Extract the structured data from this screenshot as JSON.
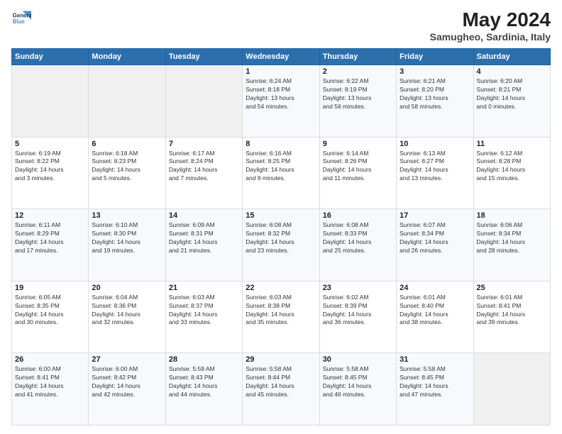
{
  "logo": {
    "line1": "General",
    "line2": "Blue"
  },
  "title": "May 2024",
  "location": "Samugheo, Sardinia, Italy",
  "weekdays": [
    "Sunday",
    "Monday",
    "Tuesday",
    "Wednesday",
    "Thursday",
    "Friday",
    "Saturday"
  ],
  "weeks": [
    [
      {
        "day": "",
        "info": ""
      },
      {
        "day": "",
        "info": ""
      },
      {
        "day": "",
        "info": ""
      },
      {
        "day": "1",
        "info": "Sunrise: 6:24 AM\nSunset: 8:18 PM\nDaylight: 13 hours\nand 54 minutes."
      },
      {
        "day": "2",
        "info": "Sunrise: 6:22 AM\nSunset: 8:19 PM\nDaylight: 13 hours\nand 56 minutes."
      },
      {
        "day": "3",
        "info": "Sunrise: 6:21 AM\nSunset: 8:20 PM\nDaylight: 13 hours\nand 58 minutes."
      },
      {
        "day": "4",
        "info": "Sunrise: 6:20 AM\nSunset: 8:21 PM\nDaylight: 14 hours\nand 0 minutes."
      }
    ],
    [
      {
        "day": "5",
        "info": "Sunrise: 6:19 AM\nSunset: 8:22 PM\nDaylight: 14 hours\nand 3 minutes."
      },
      {
        "day": "6",
        "info": "Sunrise: 6:18 AM\nSunset: 8:23 PM\nDaylight: 14 hours\nand 5 minutes."
      },
      {
        "day": "7",
        "info": "Sunrise: 6:17 AM\nSunset: 8:24 PM\nDaylight: 14 hours\nand 7 minutes."
      },
      {
        "day": "8",
        "info": "Sunrise: 6:16 AM\nSunset: 8:25 PM\nDaylight: 14 hours\nand 9 minutes."
      },
      {
        "day": "9",
        "info": "Sunrise: 6:14 AM\nSunset: 8:26 PM\nDaylight: 14 hours\nand 11 minutes."
      },
      {
        "day": "10",
        "info": "Sunrise: 6:13 AM\nSunset: 8:27 PM\nDaylight: 14 hours\nand 13 minutes."
      },
      {
        "day": "11",
        "info": "Sunrise: 6:12 AM\nSunset: 8:28 PM\nDaylight: 14 hours\nand 15 minutes."
      }
    ],
    [
      {
        "day": "12",
        "info": "Sunrise: 6:11 AM\nSunset: 8:29 PM\nDaylight: 14 hours\nand 17 minutes."
      },
      {
        "day": "13",
        "info": "Sunrise: 6:10 AM\nSunset: 8:30 PM\nDaylight: 14 hours\nand 19 minutes."
      },
      {
        "day": "14",
        "info": "Sunrise: 6:09 AM\nSunset: 8:31 PM\nDaylight: 14 hours\nand 21 minutes."
      },
      {
        "day": "15",
        "info": "Sunrise: 6:08 AM\nSunset: 8:32 PM\nDaylight: 14 hours\nand 23 minutes."
      },
      {
        "day": "16",
        "info": "Sunrise: 6:08 AM\nSunset: 8:33 PM\nDaylight: 14 hours\nand 25 minutes."
      },
      {
        "day": "17",
        "info": "Sunrise: 6:07 AM\nSunset: 8:34 PM\nDaylight: 14 hours\nand 26 minutes."
      },
      {
        "day": "18",
        "info": "Sunrise: 6:06 AM\nSunset: 8:34 PM\nDaylight: 14 hours\nand 28 minutes."
      }
    ],
    [
      {
        "day": "19",
        "info": "Sunrise: 6:05 AM\nSunset: 8:35 PM\nDaylight: 14 hours\nand 30 minutes."
      },
      {
        "day": "20",
        "info": "Sunrise: 6:04 AM\nSunset: 8:36 PM\nDaylight: 14 hours\nand 32 minutes."
      },
      {
        "day": "21",
        "info": "Sunrise: 6:03 AM\nSunset: 8:37 PM\nDaylight: 14 hours\nand 33 minutes."
      },
      {
        "day": "22",
        "info": "Sunrise: 6:03 AM\nSunset: 8:38 PM\nDaylight: 14 hours\nand 35 minutes."
      },
      {
        "day": "23",
        "info": "Sunrise: 6:02 AM\nSunset: 8:39 PM\nDaylight: 14 hours\nand 36 minutes."
      },
      {
        "day": "24",
        "info": "Sunrise: 6:01 AM\nSunset: 8:40 PM\nDaylight: 14 hours\nand 38 minutes."
      },
      {
        "day": "25",
        "info": "Sunrise: 6:01 AM\nSunset: 8:41 PM\nDaylight: 14 hours\nand 39 minutes."
      }
    ],
    [
      {
        "day": "26",
        "info": "Sunrise: 6:00 AM\nSunset: 8:41 PM\nDaylight: 14 hours\nand 41 minutes."
      },
      {
        "day": "27",
        "info": "Sunrise: 6:00 AM\nSunset: 8:42 PM\nDaylight: 14 hours\nand 42 minutes."
      },
      {
        "day": "28",
        "info": "Sunrise: 5:59 AM\nSunset: 8:43 PM\nDaylight: 14 hours\nand 44 minutes."
      },
      {
        "day": "29",
        "info": "Sunrise: 5:58 AM\nSunset: 8:44 PM\nDaylight: 14 hours\nand 45 minutes."
      },
      {
        "day": "30",
        "info": "Sunrise: 5:58 AM\nSunset: 8:45 PM\nDaylight: 14 hours\nand 46 minutes."
      },
      {
        "day": "31",
        "info": "Sunrise: 5:58 AM\nSunset: 8:45 PM\nDaylight: 14 hours\nand 47 minutes."
      },
      {
        "day": "",
        "info": ""
      }
    ]
  ]
}
